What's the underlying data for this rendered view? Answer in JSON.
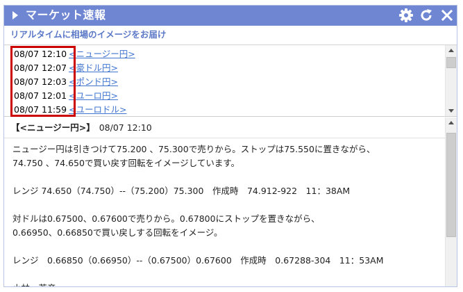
{
  "header": {
    "title": "マーケット速報",
    "controls": [
      "gear-icon",
      "refresh-icon",
      "close-icon"
    ]
  },
  "subtitle": "リアルタイムに相場のイメージをお届け",
  "news": [
    {
      "time": "08/07 12:10",
      "label": "<ニュージー円>"
    },
    {
      "time": "08/07 12:07",
      "label": "<豪ドル円>"
    },
    {
      "time": "08/07 12:03",
      "label": "<ポンド円>"
    },
    {
      "time": "08/07 12:01",
      "label": "<ユーロ円>"
    },
    {
      "time": "08/07 11:59",
      "label": "<ユーロドル>"
    }
  ],
  "article": {
    "headline": "【<ニュージー円>】",
    "date": "08/07 12:10",
    "lines": [
      "ニュージー円は引きつけて75.200 、75.300で売りから。ストップは75.550に置きながら、",
      "74.750 、74.650で買い戻す回転をイメージしています。",
      "",
      "レンジ 74.650（74.750）--（75.200）75.300　作成時　74.912-922　11：38AM",
      "",
      "対ドルは0.67500、0.67600で売りから。0.67800にストップを置きながら、",
      "0.66950、0.66850で買い戻しする回転をイメージ。",
      "",
      "レンジ　0.66850（0.66950）--（0.67500）0.67600　作成時　0.67288-304　11：53AM",
      "",
      "小林　芳彦"
    ]
  },
  "colors": {
    "header_bg": "#6f86d3",
    "subtitle": "#5c79c8",
    "link": "#3f74cf",
    "highlight": "#cc0000"
  }
}
